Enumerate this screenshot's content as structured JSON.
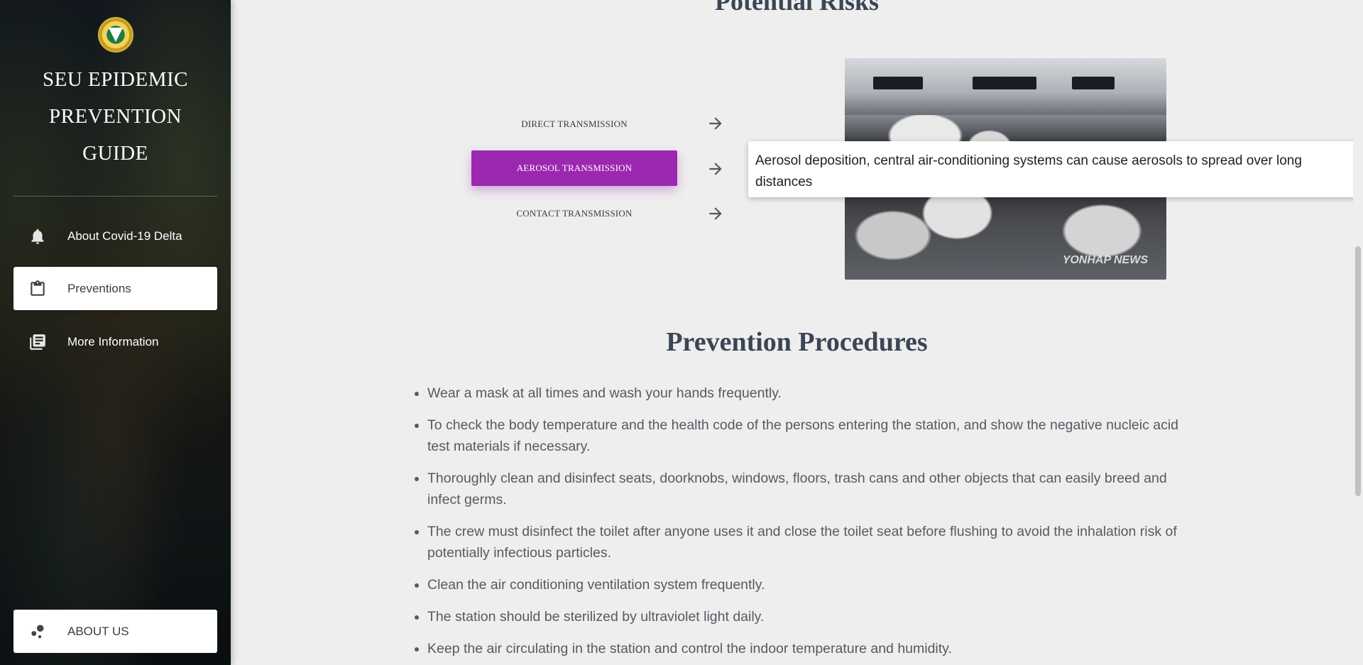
{
  "sidebar": {
    "logo_icon": "university-seal-icon",
    "brand_lines": [
      "SEU EPIDEMIC",
      "PREVENTION",
      "GUIDE"
    ],
    "nav": [
      {
        "label": "About Covid-19 Delta",
        "icon": "bell-icon",
        "active": false
      },
      {
        "label": "Preventions",
        "icon": "clipboard-icon",
        "active": true
      },
      {
        "label": "More Information",
        "icon": "library-books-icon",
        "active": false
      }
    ],
    "about": {
      "label": "ABOUT US",
      "icon": "bubble-chart-icon"
    }
  },
  "risks": {
    "title": "Potential Risks",
    "tabs": [
      {
        "label": "DIRECT TRANSMISSION",
        "active": false
      },
      {
        "label": "AEROSOL TRANSMISSION",
        "active": true
      },
      {
        "label": "CONTACT TRANSMISSION",
        "active": false
      }
    ],
    "tooltip": "Aerosol deposition, central air-conditioning systems can cause aerosols to spread over long distances",
    "photo_watermark": "YONHAP NEWS"
  },
  "procedures": {
    "title": "Prevention Procedures",
    "items": [
      "Wear a mask at all times and wash your hands frequently.",
      "To check the body temperature and the health code of the persons entering the station, and show the negative nucleic acid test materials if necessary.",
      "Thoroughly clean and disinfect seats, doorknobs, windows, floors, trash cans and other objects that can easily breed and infect germs.",
      "The crew must disinfect the toilet after anyone uses it and close the toilet seat before flushing to avoid the inhalation risk of potentially infectious particles.",
      "Clean the air conditioning ventilation system frequently.",
      "The station should be sterilized by ultraviolet light daily.",
      "Keep the air circulating in the station and control the indoor temperature and humidity."
    ]
  },
  "colors": {
    "accent": "#9c27b0",
    "background": "#eeeeee",
    "title": "#3a4655"
  }
}
